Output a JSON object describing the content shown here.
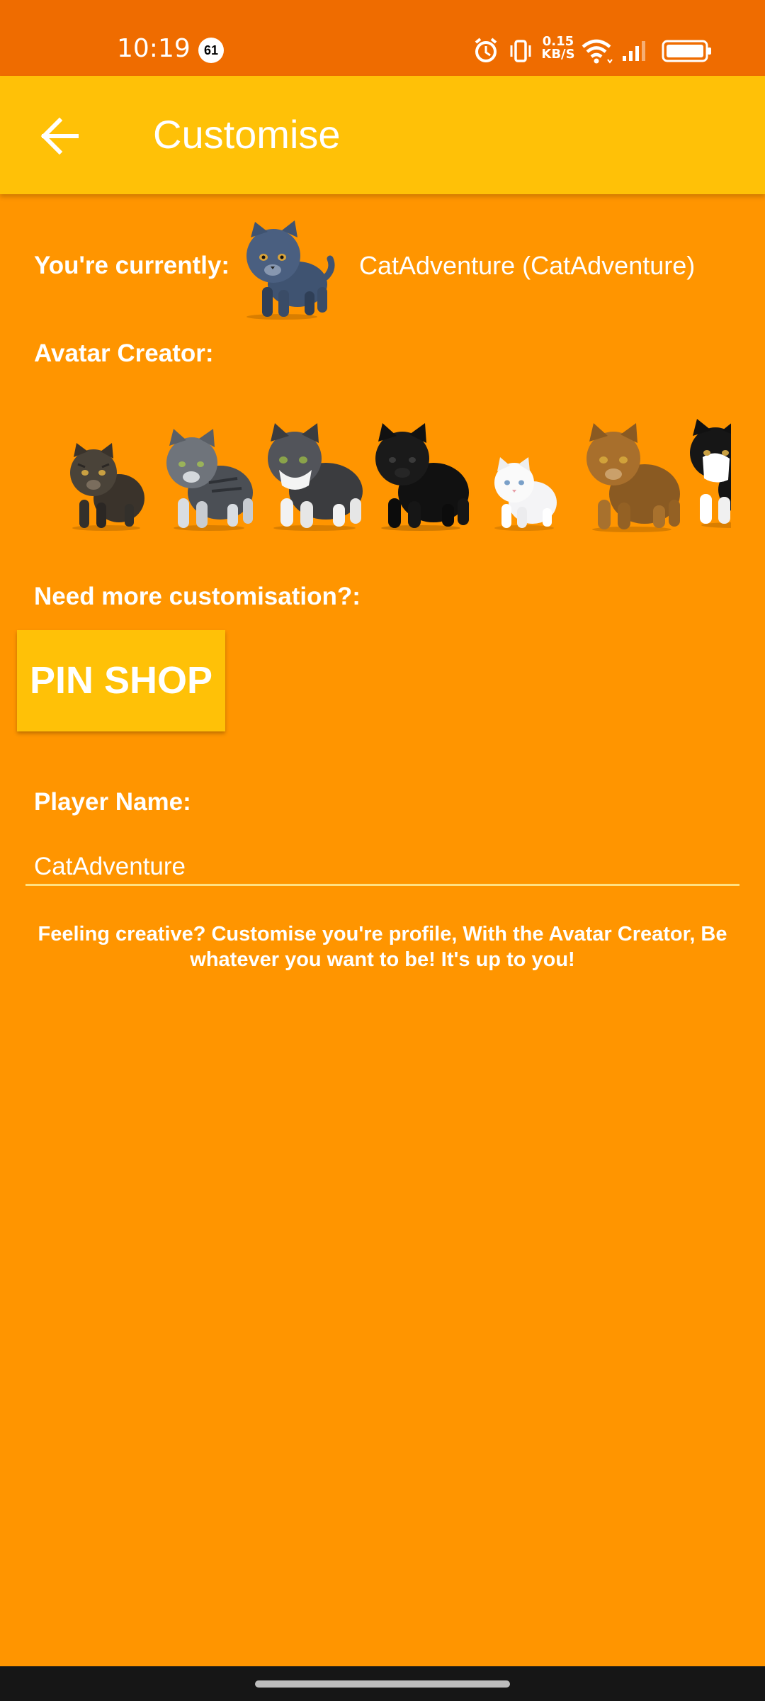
{
  "status_bar": {
    "time": "10:19",
    "notification_count": "61",
    "net_speed_value": "0.15",
    "net_speed_unit": "KB/S",
    "icons": [
      "alarm-icon",
      "vibrate-icon",
      "wifi-icon",
      "signal-icon",
      "battery-icon"
    ]
  },
  "app_bar": {
    "title": "Customise",
    "back_icon": "arrow-back-icon"
  },
  "current": {
    "label": "You're currently:",
    "name": "CatAdventure (CatAdventure)",
    "avatar": "blue-grey-cat"
  },
  "avatar_creator": {
    "label": "Avatar Creator:",
    "options": [
      "tabby-cat",
      "grey-striped-cat",
      "grey-white-cat",
      "black-cat",
      "white-cat",
      "ginger-cat",
      "black-white-cat"
    ]
  },
  "customisation": {
    "label": "Need more customisation?:",
    "button_label": "PIN SHOP"
  },
  "player_name": {
    "label": "Player Name:",
    "value": "CatAdventure"
  },
  "info_text": "Feeling creative? Customise you're profile, With the Avatar Creator, Be whatever you want to be! It's up to you!",
  "colors": {
    "background": "#ff9500",
    "status_bar": "#ef6c00",
    "app_bar": "#ffc107",
    "accent": "#ffc107",
    "nav_bar": "#161616"
  }
}
